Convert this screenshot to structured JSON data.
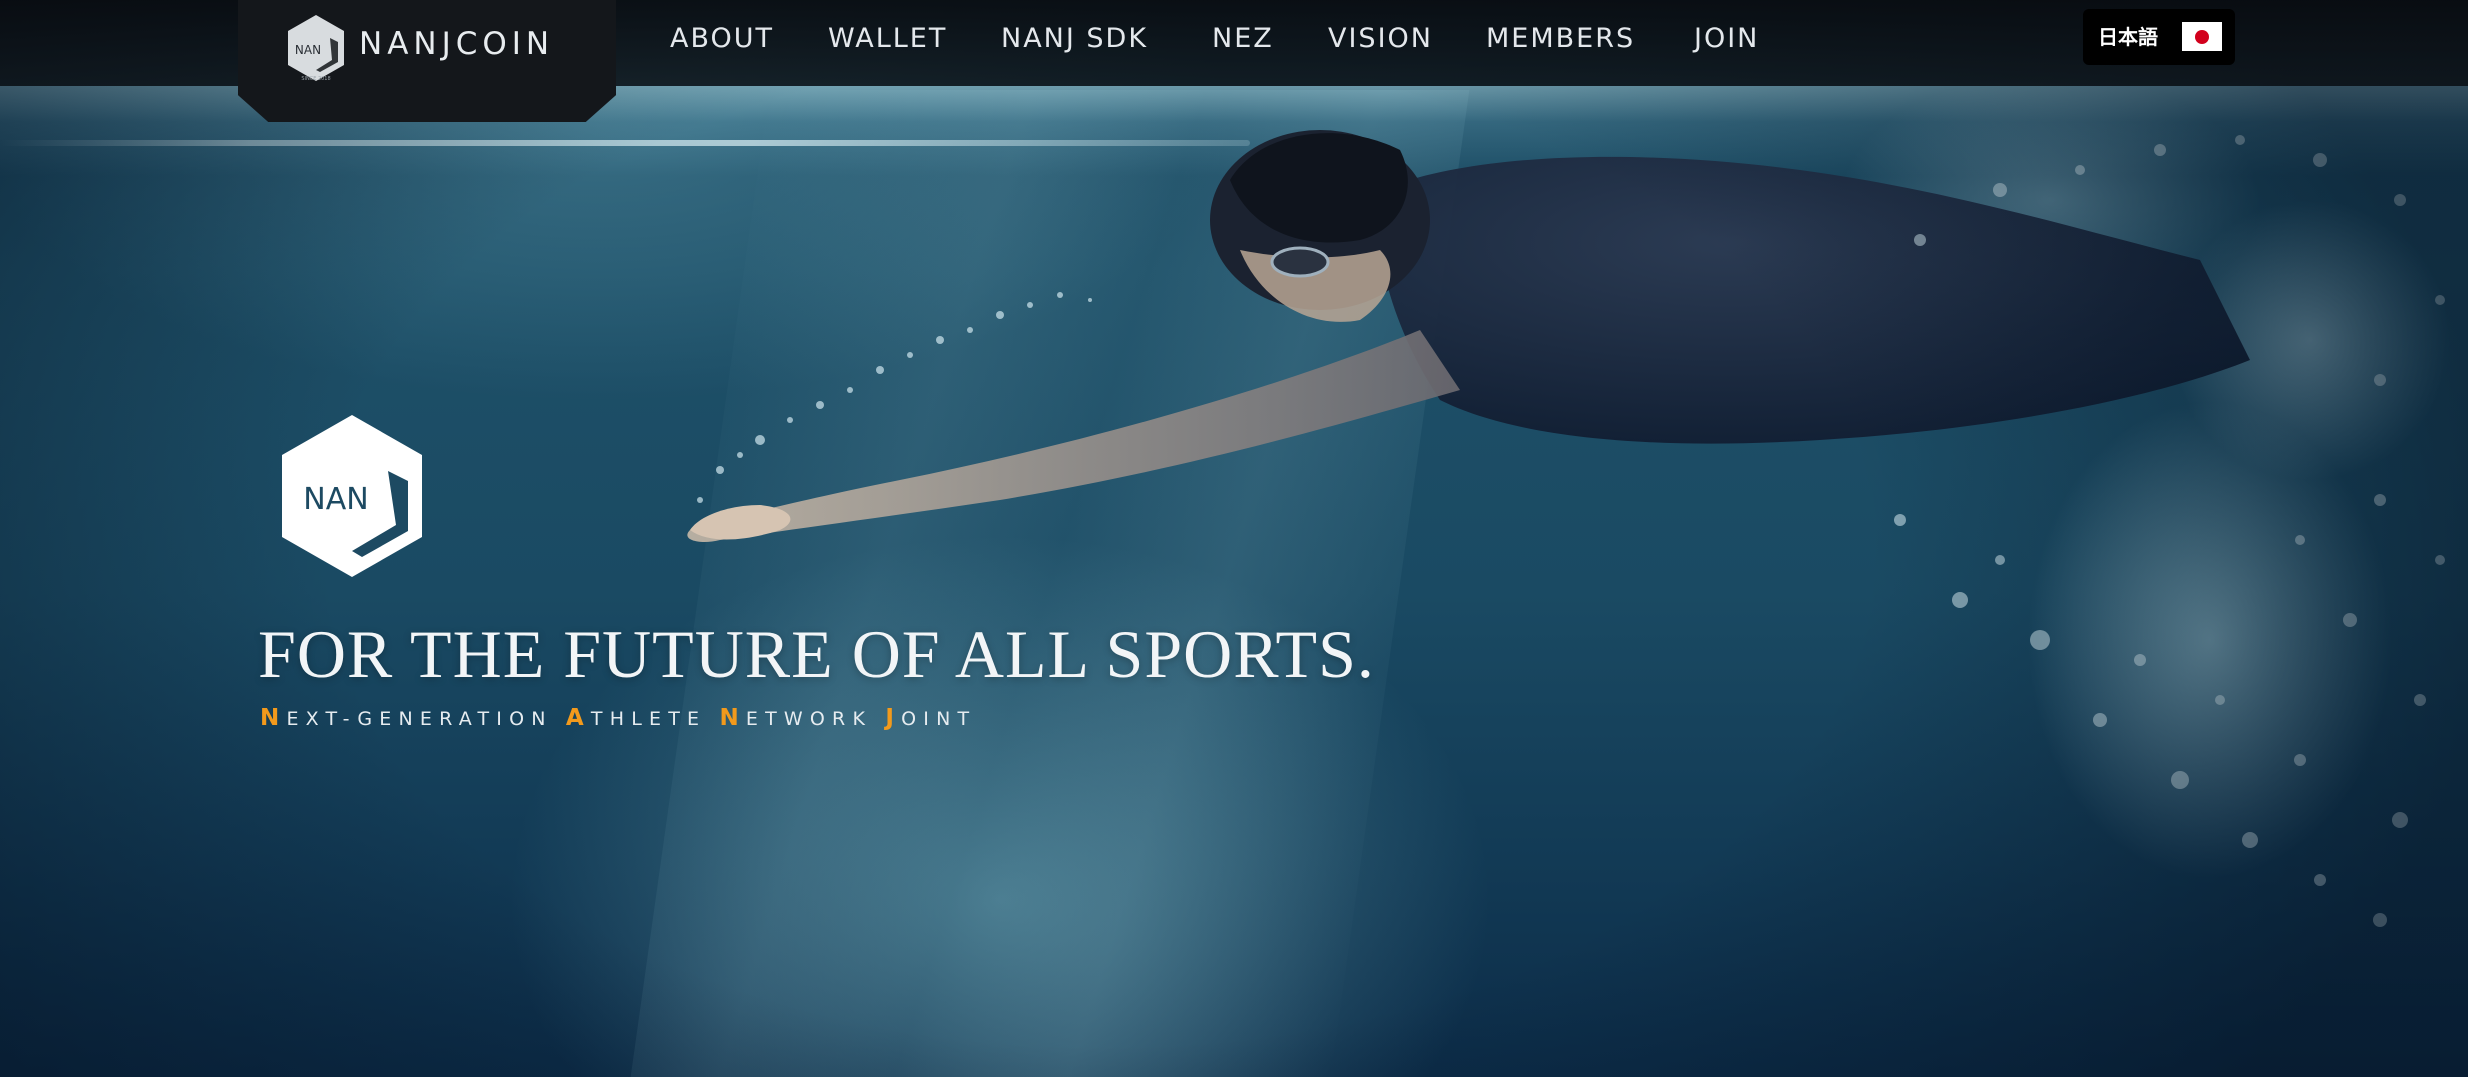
{
  "header": {
    "logo": {
      "mark_text": "NAN",
      "mark_caption": "SINCE 2018",
      "wordmark": "NANJCOIN"
    },
    "nav": [
      {
        "label": "ABOUT"
      },
      {
        "label": "WALLET"
      },
      {
        "label": "NANJ SDK"
      },
      {
        "label": "NEZ"
      },
      {
        "label": "VISION"
      },
      {
        "label": "MEMBERS"
      },
      {
        "label": "JOIN"
      }
    ],
    "language": {
      "label": "日本語",
      "flag_icon": "japan-flag-icon"
    }
  },
  "hero": {
    "logo_text": "NAN",
    "title": "FOR THE FUTURE OF ALL SPORTS.",
    "subtitle": [
      {
        "cap": "N",
        "rest": "EXT-GENERATION"
      },
      {
        "cap": "A",
        "rest": "THLETE"
      },
      {
        "cap": "N",
        "rest": "ETWORK"
      },
      {
        "cap": "J",
        "rest": "OINT"
      }
    ]
  },
  "colors": {
    "accent": "#f29a1c",
    "nav_bg": "#0e1216",
    "flag_red": "#d2001c"
  }
}
